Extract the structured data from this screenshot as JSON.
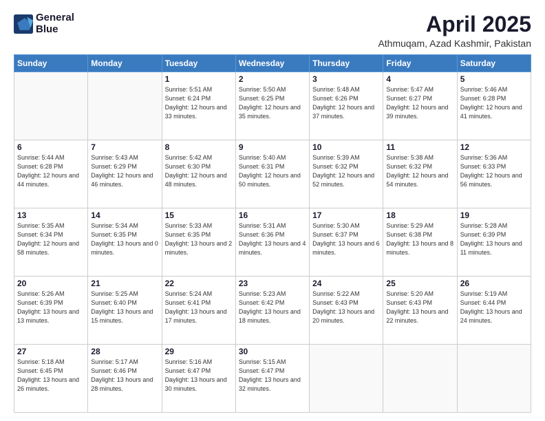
{
  "logo": {
    "line1": "General",
    "line2": "Blue"
  },
  "title": "April 2025",
  "subtitle": "Athmuqam, Azad Kashmir, Pakistan",
  "weekdays": [
    "Sunday",
    "Monday",
    "Tuesday",
    "Wednesday",
    "Thursday",
    "Friday",
    "Saturday"
  ],
  "weeks": [
    [
      {
        "day": "",
        "sunrise": "",
        "sunset": "",
        "daylight": ""
      },
      {
        "day": "",
        "sunrise": "",
        "sunset": "",
        "daylight": ""
      },
      {
        "day": "1",
        "sunrise": "Sunrise: 5:51 AM",
        "sunset": "Sunset: 6:24 PM",
        "daylight": "Daylight: 12 hours and 33 minutes."
      },
      {
        "day": "2",
        "sunrise": "Sunrise: 5:50 AM",
        "sunset": "Sunset: 6:25 PM",
        "daylight": "Daylight: 12 hours and 35 minutes."
      },
      {
        "day": "3",
        "sunrise": "Sunrise: 5:48 AM",
        "sunset": "Sunset: 6:26 PM",
        "daylight": "Daylight: 12 hours and 37 minutes."
      },
      {
        "day": "4",
        "sunrise": "Sunrise: 5:47 AM",
        "sunset": "Sunset: 6:27 PM",
        "daylight": "Daylight: 12 hours and 39 minutes."
      },
      {
        "day": "5",
        "sunrise": "Sunrise: 5:46 AM",
        "sunset": "Sunset: 6:28 PM",
        "daylight": "Daylight: 12 hours and 41 minutes."
      }
    ],
    [
      {
        "day": "6",
        "sunrise": "Sunrise: 5:44 AM",
        "sunset": "Sunset: 6:28 PM",
        "daylight": "Daylight: 12 hours and 44 minutes."
      },
      {
        "day": "7",
        "sunrise": "Sunrise: 5:43 AM",
        "sunset": "Sunset: 6:29 PM",
        "daylight": "Daylight: 12 hours and 46 minutes."
      },
      {
        "day": "8",
        "sunrise": "Sunrise: 5:42 AM",
        "sunset": "Sunset: 6:30 PM",
        "daylight": "Daylight: 12 hours and 48 minutes."
      },
      {
        "day": "9",
        "sunrise": "Sunrise: 5:40 AM",
        "sunset": "Sunset: 6:31 PM",
        "daylight": "Daylight: 12 hours and 50 minutes."
      },
      {
        "day": "10",
        "sunrise": "Sunrise: 5:39 AM",
        "sunset": "Sunset: 6:32 PM",
        "daylight": "Daylight: 12 hours and 52 minutes."
      },
      {
        "day": "11",
        "sunrise": "Sunrise: 5:38 AM",
        "sunset": "Sunset: 6:32 PM",
        "daylight": "Daylight: 12 hours and 54 minutes."
      },
      {
        "day": "12",
        "sunrise": "Sunrise: 5:36 AM",
        "sunset": "Sunset: 6:33 PM",
        "daylight": "Daylight: 12 hours and 56 minutes."
      }
    ],
    [
      {
        "day": "13",
        "sunrise": "Sunrise: 5:35 AM",
        "sunset": "Sunset: 6:34 PM",
        "daylight": "Daylight: 12 hours and 58 minutes."
      },
      {
        "day": "14",
        "sunrise": "Sunrise: 5:34 AM",
        "sunset": "Sunset: 6:35 PM",
        "daylight": "Daylight: 13 hours and 0 minutes."
      },
      {
        "day": "15",
        "sunrise": "Sunrise: 5:33 AM",
        "sunset": "Sunset: 6:35 PM",
        "daylight": "Daylight: 13 hours and 2 minutes."
      },
      {
        "day": "16",
        "sunrise": "Sunrise: 5:31 AM",
        "sunset": "Sunset: 6:36 PM",
        "daylight": "Daylight: 13 hours and 4 minutes."
      },
      {
        "day": "17",
        "sunrise": "Sunrise: 5:30 AM",
        "sunset": "Sunset: 6:37 PM",
        "daylight": "Daylight: 13 hours and 6 minutes."
      },
      {
        "day": "18",
        "sunrise": "Sunrise: 5:29 AM",
        "sunset": "Sunset: 6:38 PM",
        "daylight": "Daylight: 13 hours and 8 minutes."
      },
      {
        "day": "19",
        "sunrise": "Sunrise: 5:28 AM",
        "sunset": "Sunset: 6:39 PM",
        "daylight": "Daylight: 13 hours and 11 minutes."
      }
    ],
    [
      {
        "day": "20",
        "sunrise": "Sunrise: 5:26 AM",
        "sunset": "Sunset: 6:39 PM",
        "daylight": "Daylight: 13 hours and 13 minutes."
      },
      {
        "day": "21",
        "sunrise": "Sunrise: 5:25 AM",
        "sunset": "Sunset: 6:40 PM",
        "daylight": "Daylight: 13 hours and 15 minutes."
      },
      {
        "day": "22",
        "sunrise": "Sunrise: 5:24 AM",
        "sunset": "Sunset: 6:41 PM",
        "daylight": "Daylight: 13 hours and 17 minutes."
      },
      {
        "day": "23",
        "sunrise": "Sunrise: 5:23 AM",
        "sunset": "Sunset: 6:42 PM",
        "daylight": "Daylight: 13 hours and 18 minutes."
      },
      {
        "day": "24",
        "sunrise": "Sunrise: 5:22 AM",
        "sunset": "Sunset: 6:43 PM",
        "daylight": "Daylight: 13 hours and 20 minutes."
      },
      {
        "day": "25",
        "sunrise": "Sunrise: 5:20 AM",
        "sunset": "Sunset: 6:43 PM",
        "daylight": "Daylight: 13 hours and 22 minutes."
      },
      {
        "day": "26",
        "sunrise": "Sunrise: 5:19 AM",
        "sunset": "Sunset: 6:44 PM",
        "daylight": "Daylight: 13 hours and 24 minutes."
      }
    ],
    [
      {
        "day": "27",
        "sunrise": "Sunrise: 5:18 AM",
        "sunset": "Sunset: 6:45 PM",
        "daylight": "Daylight: 13 hours and 26 minutes."
      },
      {
        "day": "28",
        "sunrise": "Sunrise: 5:17 AM",
        "sunset": "Sunset: 6:46 PM",
        "daylight": "Daylight: 13 hours and 28 minutes."
      },
      {
        "day": "29",
        "sunrise": "Sunrise: 5:16 AM",
        "sunset": "Sunset: 6:47 PM",
        "daylight": "Daylight: 13 hours and 30 minutes."
      },
      {
        "day": "30",
        "sunrise": "Sunrise: 5:15 AM",
        "sunset": "Sunset: 6:47 PM",
        "daylight": "Daylight: 13 hours and 32 minutes."
      },
      {
        "day": "",
        "sunrise": "",
        "sunset": "",
        "daylight": ""
      },
      {
        "day": "",
        "sunrise": "",
        "sunset": "",
        "daylight": ""
      },
      {
        "day": "",
        "sunrise": "",
        "sunset": "",
        "daylight": ""
      }
    ]
  ]
}
